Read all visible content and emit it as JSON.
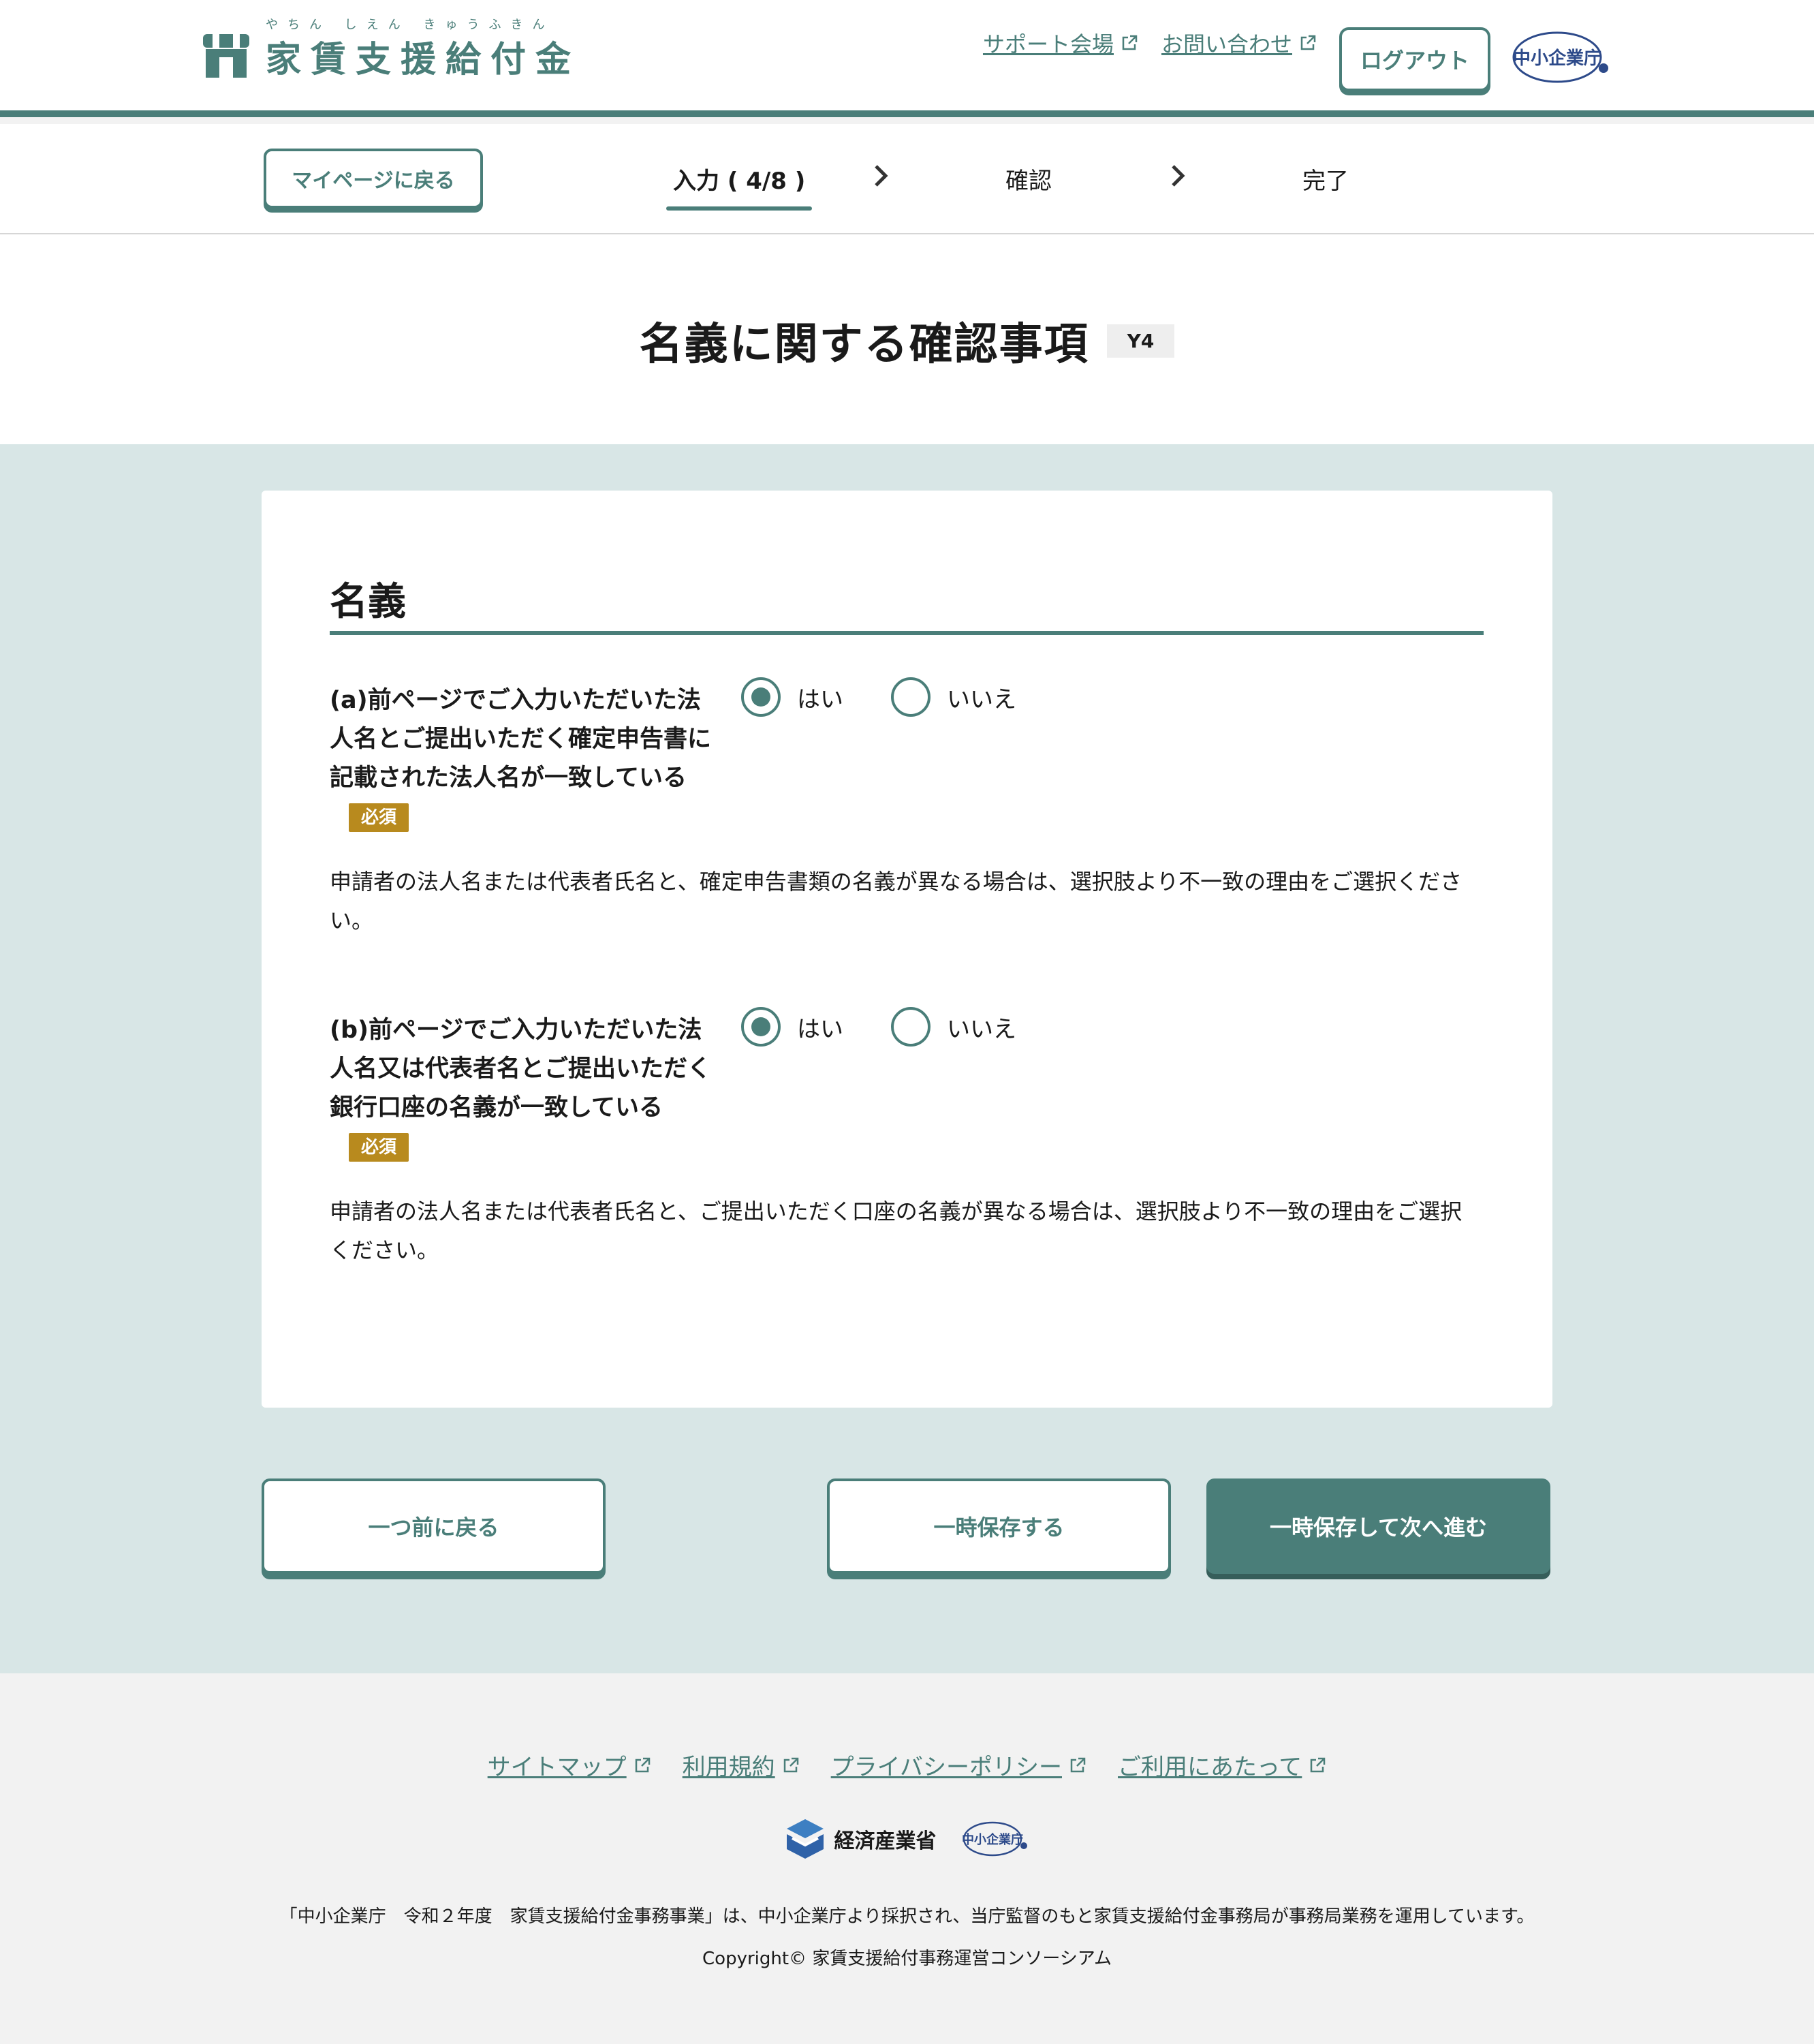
{
  "header": {
    "logo_ruby": "やちん しえん きゅうふきん",
    "logo_text": "家賃支援給付金",
    "links": [
      {
        "label": "サポート会場"
      },
      {
        "label": "お問い合わせ"
      }
    ],
    "logout_label": "ログアウト",
    "agency_logo_text": "中小企業庁"
  },
  "stepnav": {
    "back_label": "マイページに戻る",
    "steps": [
      {
        "label": "入力 ( 4/8 )",
        "active": true
      },
      {
        "label": "確認"
      },
      {
        "label": "完了"
      }
    ]
  },
  "page": {
    "title": "名義に関する確認事項",
    "code": "Y4"
  },
  "section": {
    "title": "名義",
    "required_label": "必須",
    "questions": [
      {
        "label": "(a)前ページでご入力いただいた法人名とご提出いただく確定申告書に記載された法人名が一致している",
        "options": [
          "はい",
          "いいえ"
        ],
        "selected": "はい",
        "note": "申請者の法人名または代表者氏名と、確定申告書類の名義が異なる場合は、選択肢より不一致の理由をご選択ください。"
      },
      {
        "label": "(b)前ページでご入力いただいた法人名又は代表者名とご提出いただく銀行口座の名義が一致している",
        "options": [
          "はい",
          "いいえ"
        ],
        "selected": "はい",
        "note": "申請者の法人名または代表者氏名と、ご提出いただく口座の名義が異なる場合は、選択肢より不一致の理由をご選択ください。"
      }
    ]
  },
  "actions": {
    "back_label": "一つ前に戻る",
    "save_label": "一時保存する",
    "next_label": "一時保存して次へ進む"
  },
  "footer": {
    "links": [
      "サイトマップ",
      "利用規約",
      "プライバシーポリシー",
      "ご利用にあたって"
    ],
    "meti_label": "経済産業省",
    "agency_logo_text": "中小企業庁",
    "note": "「中小企業庁　令和２年度　家賃支援給付金事務事業」は、中小企業庁より採択され、当庁監督のもと家賃支援給付金事務局が事務局業務を運用しています。",
    "copyright": "Copyright© 家賃支援給付事務運営コンソーシアム"
  },
  "colors": {
    "brand": "#4a7e79",
    "main_bg": "#d8e6e6",
    "required_badge": "#b88a1e",
    "footer_bg": "#f2f2f2"
  },
  "icons": [
    "shop-logo-icon",
    "external-link-icon",
    "chevron-right-icon",
    "radio-icon"
  ]
}
